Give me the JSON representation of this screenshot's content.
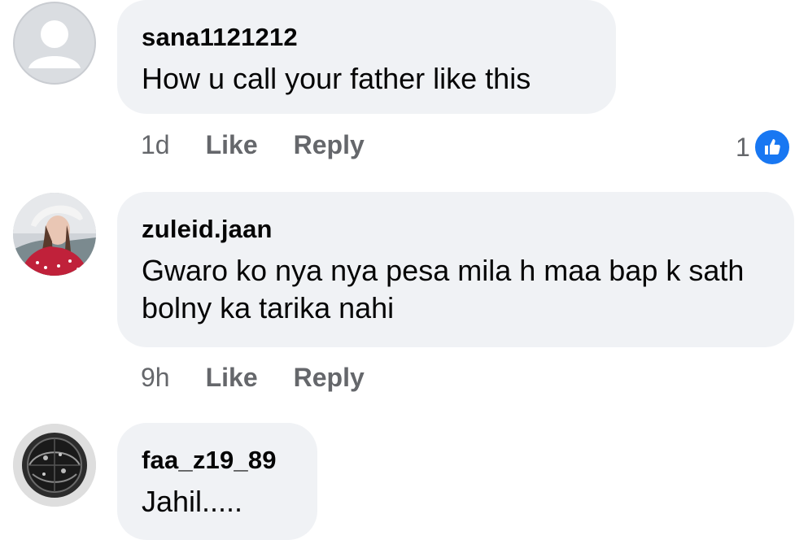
{
  "comments": [
    {
      "author": "sana1121212",
      "text": "How u call your father like this",
      "time": "1d",
      "like_label": "Like",
      "reply_label": "Reply",
      "reaction_count": "1",
      "avatar_icon": "default-avatar-icon"
    },
    {
      "author": "zuleid.jaan",
      "text": "Gwaro ko nya nya pesa mila h maa bap k sath bolny ka tarika nahi",
      "time": "9h",
      "like_label": "Like",
      "reply_label": "Reply",
      "avatar_icon": "profile-photo-icon"
    },
    {
      "author": "faa_z19_89",
      "text": "Jahil.....",
      "avatar_icon": "profile-photo-icon"
    }
  ],
  "colors": {
    "bubble_bg": "#f0f2f5",
    "meta_text": "#65676b",
    "like_blue": "#1877f2"
  }
}
